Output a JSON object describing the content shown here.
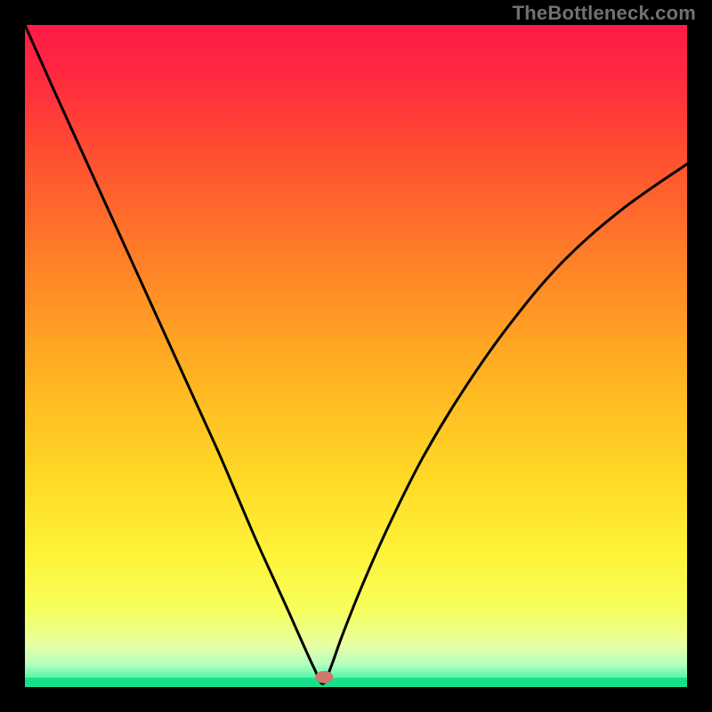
{
  "watermark": "TheBottleneck.com",
  "plot": {
    "inner_left": 28,
    "inner_top": 28,
    "inner_width": 744,
    "inner_height": 744,
    "gradient_stops": [
      {
        "offset": 0.0,
        "color": "#ff1a47"
      },
      {
        "offset": 0.08,
        "color": "#ff2a3f"
      },
      {
        "offset": 0.18,
        "color": "#ff4a33"
      },
      {
        "offset": 0.3,
        "color": "#ff6f2a"
      },
      {
        "offset": 0.42,
        "color": "#ff9325"
      },
      {
        "offset": 0.55,
        "color": "#ffb822"
      },
      {
        "offset": 0.68,
        "color": "#ffd825"
      },
      {
        "offset": 0.8,
        "color": "#fff33a"
      },
      {
        "offset": 0.88,
        "color": "#f6ff5a"
      },
      {
        "offset": 0.935,
        "color": "#e9ffa0"
      },
      {
        "offset": 0.965,
        "color": "#b8ffc2"
      },
      {
        "offset": 0.985,
        "color": "#59f7a7"
      },
      {
        "offset": 1.0,
        "color": "#1be08f"
      }
    ],
    "green_band": {
      "y_frac": 0.986,
      "h_frac": 0.014,
      "color": "#18df8d"
    }
  },
  "marker": {
    "x_frac": 0.452,
    "y_frac": 0.985,
    "rx": 10,
    "ry": 7,
    "fill": "#cb7a6c"
  },
  "chart_data": {
    "type": "line",
    "title": "",
    "xlabel": "",
    "ylabel": "",
    "xlim": [
      0,
      1
    ],
    "ylim": [
      0,
      1
    ],
    "note": "No axes or tick labels are visible; x/y are normalized fractions of the plot area. y=1 is top, y=0 is bottom. The curve is a V-shape touching the bottom near x≈0.45; x>0.45 branch rises more gradually.",
    "series": [
      {
        "name": "curve",
        "color": "#000000",
        "stroke_width": 3,
        "x": [
          0.0,
          0.04,
          0.09,
          0.14,
          0.19,
          0.24,
          0.29,
          0.32,
          0.35,
          0.375,
          0.4,
          0.42,
          0.437,
          0.45,
          0.462,
          0.48,
          0.51,
          0.55,
          0.6,
          0.66,
          0.73,
          0.81,
          0.9,
          1.0
        ],
        "y": [
          1.0,
          0.91,
          0.8,
          0.69,
          0.58,
          0.47,
          0.36,
          0.29,
          0.22,
          0.165,
          0.11,
          0.065,
          0.028,
          0.005,
          0.03,
          0.08,
          0.155,
          0.245,
          0.345,
          0.445,
          0.545,
          0.64,
          0.72,
          0.79
        ]
      }
    ],
    "marker_point": {
      "x": 0.452,
      "y": 0.015
    }
  }
}
